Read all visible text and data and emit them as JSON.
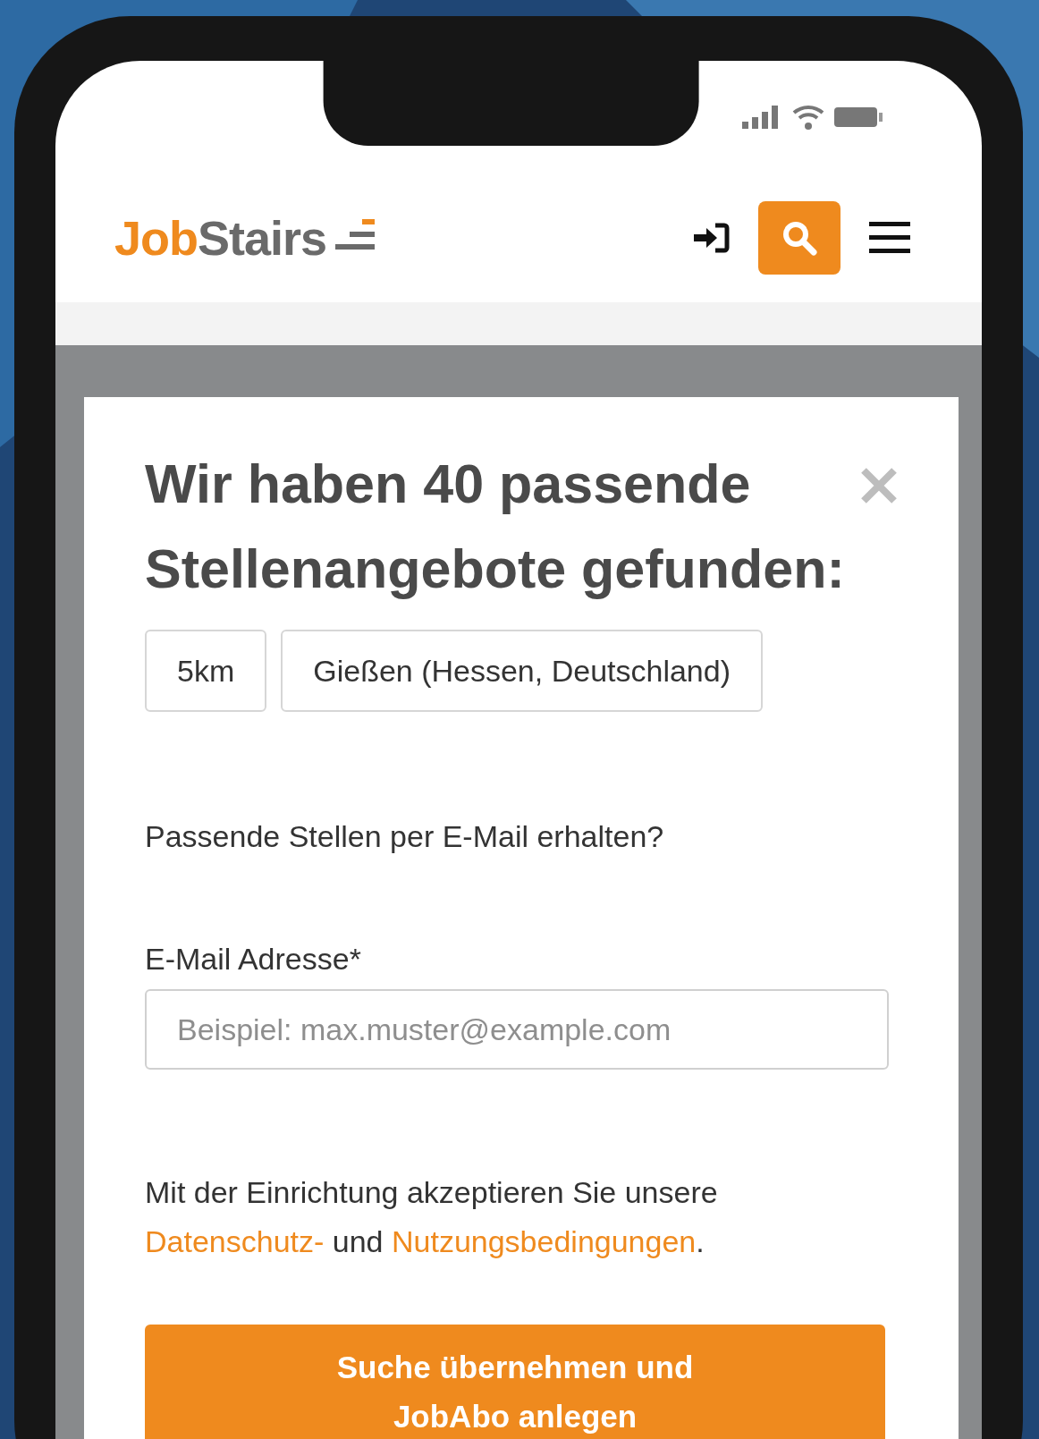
{
  "header": {
    "logo": {
      "primary": "Job",
      "secondary": "Stairs"
    }
  },
  "modal": {
    "title": "Wir haben 40 passende Stellenangebote gefunden:",
    "radius": "5km",
    "location": "Gießen (Hessen, Deutschland)",
    "prompt": "Passende Stellen per E-Mail erhalten?",
    "email": {
      "label": "E-Mail Adresse*",
      "placeholder": "Beispiel: max.muster@example.com"
    },
    "consent": {
      "text": "Mit der Einrichtung akzeptieren Sie unsere",
      "link_1": "Datenschutz-",
      "joiner": "und",
      "link_2": "Nutzungsbedingungen",
      "end": "."
    },
    "submit": "Suche übernehmen und JobAbo anlegen"
  }
}
